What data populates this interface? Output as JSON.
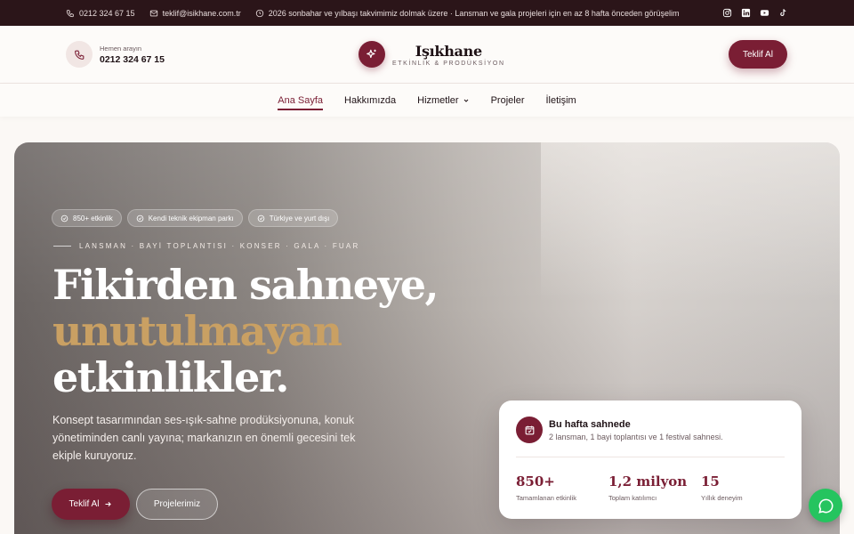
{
  "topbar": {
    "phone": "0212 324 67 15",
    "email": "teklif@isikhane.com.tr",
    "notice": "2026 sonbahar ve yılbaşı takvimimiz dolmak üzere · Lansman ve gala projeleri için en az 8 hafta önceden görüşelim",
    "social_icons": [
      "instagram-icon",
      "linkedin-icon",
      "youtube-icon",
      "tiktok-icon"
    ]
  },
  "header": {
    "call_hint": "Hemen arayın",
    "call_number": "0212 324 67 15",
    "brand_name": "Işıkhane",
    "brand_tagline": "ETKİNLİK & PRODÜKSİYON",
    "cta_label": "Teklif Al"
  },
  "nav": {
    "items": [
      {
        "label": "Ana Sayfa",
        "active": true
      },
      {
        "label": "Hakkımızda"
      },
      {
        "label": "Hizmetler"
      },
      {
        "label": "Projeler"
      },
      {
        "label": "İletişim"
      }
    ]
  },
  "hero": {
    "chips": [
      "850+ etkinlik",
      "Kendi teknik ekipman parkı",
      "Türkiye ve yurt dışı"
    ],
    "eyebrow": "LANSMAN · BAYİ TOPLANTISI · KONSER · GALA · FUAR",
    "headline_line1": "Fikirden sahneye,",
    "headline_accent": "unutulmayan",
    "headline_line3": "etkinlikler.",
    "lead": "Konsept tasarımından ses-ışık-sahne prodüksiyonuna, konuk yönetiminden canlı yayına; markanızın en önemli gecesini tek ekiple kuruyoruz.",
    "primary_cta": "Teklif Al",
    "secondary_cta": "Projelerimiz"
  },
  "card": {
    "title": "Bu hafta sahnede",
    "subtitle": "2 lansman, 1 bayi toplantısı ve 1 festival sahnesi.",
    "stats": [
      {
        "value": "850+",
        "label": "Tamamlanan etkinlik"
      },
      {
        "value": "1,2 milyon",
        "label": "Toplam katılımcı"
      },
      {
        "value": "15",
        "label": "Yıllık deneyim"
      }
    ]
  },
  "colors": {
    "brand": "#7a1e34",
    "accent_gold": "#c9a063",
    "topbar_bg": "#2b1519",
    "whatsapp": "#25c45f"
  }
}
